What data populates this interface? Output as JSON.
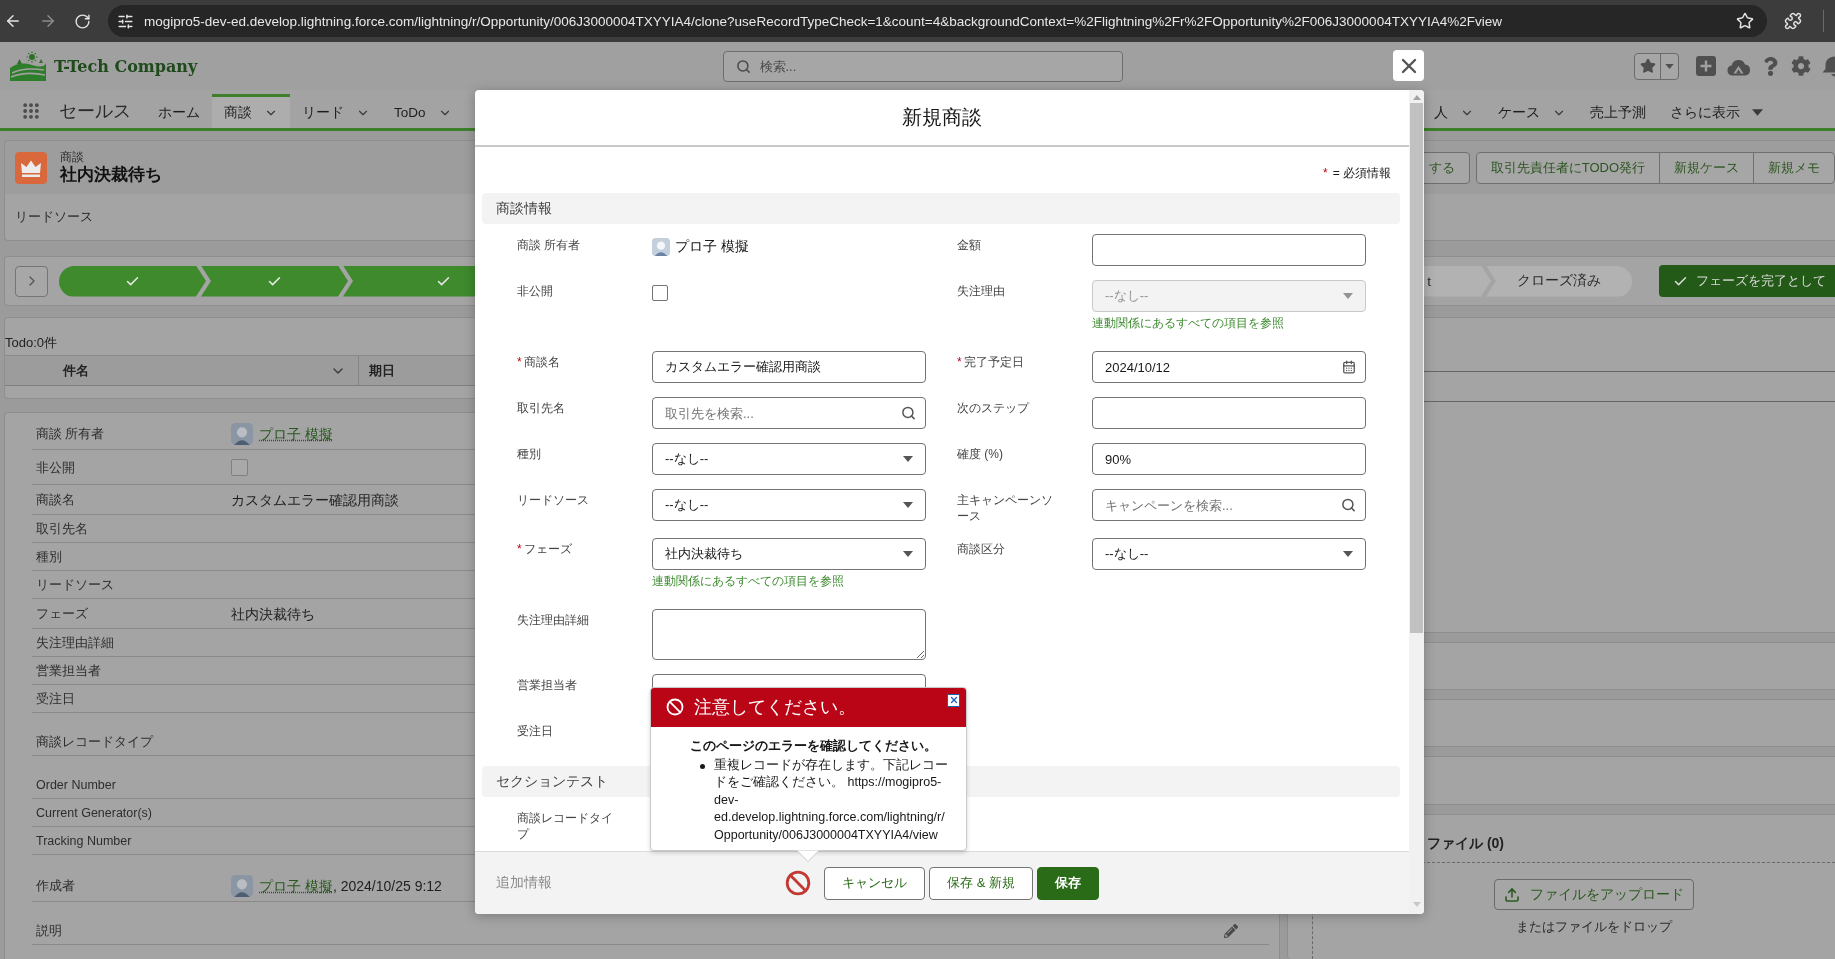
{
  "browser": {
    "url": "mogipro5-dev-ed.develop.lightning.force.com/lightning/r/Opportunity/006J3000004TXYYIA4/clone?useRecordTypeCheck=1&count=4&backgroundContext=%2Flightning%2Fr%2FOpportunity%2F006J3000004TXYYIA4%2Fview"
  },
  "header": {
    "brand": "T-Tech Company",
    "search": {
      "placeholder": "検索..."
    }
  },
  "nav": {
    "app_name": "セールス",
    "items": [
      {
        "label": "ホーム",
        "kind": "link",
        "selected": false
      },
      {
        "label": "商談",
        "kind": "dropdown",
        "selected": true
      },
      {
        "label": "リード",
        "kind": "dropdown",
        "selected": false
      },
      {
        "label": "ToDo",
        "kind": "dropdown",
        "selected": false
      }
    ],
    "overflow_items": [
      {
        "label": "人",
        "kind": "dropdown",
        "selected": false
      },
      {
        "label": "ケース",
        "kind": "dropdown",
        "selected": false
      },
      {
        "label": "売上予測",
        "kind": "link",
        "selected": false
      },
      {
        "label": "さらに表示",
        "kind": "more",
        "selected": false
      }
    ]
  },
  "record": {
    "object_label": "商談",
    "title": "社内決裁待ち",
    "field_label": "リードソース",
    "action_groups": [
      [
        "する"
      ],
      [
        "取引先責任者にTODO発行",
        "新規ケース",
        "新規メモ"
      ]
    ]
  },
  "path": {
    "leading_stages": [
      {
        "completed": true
      },
      {
        "completed": true
      },
      {
        "completed": true
      }
    ],
    "trailing_stages": [
      {
        "label": "t",
        "completed": false
      },
      {
        "label": "クローズ済み",
        "completed": false
      }
    ],
    "complete_button": "フェーズを完了として"
  },
  "activity": {
    "todo_count": "Todo:0件",
    "columns": [
      {
        "label": "件名",
        "menu": true
      },
      {
        "label": "期日"
      }
    ]
  },
  "details": {
    "groups": [
      {
        "rows": [
          {
            "label": "商談 所有者",
            "kind": "user",
            "value": "プロ子 模擬",
            "editable": false
          },
          {
            "label": "非公開",
            "kind": "checkbox",
            "checked": false,
            "editable": false
          },
          {
            "label": "商談名",
            "kind": "text",
            "value": "カスタムエラー確認用商談",
            "editable": false
          },
          {
            "label": "取引先名",
            "kind": "text",
            "editable": false
          },
          {
            "label": "種別",
            "kind": "text",
            "editable": false
          },
          {
            "label": "リードソース",
            "kind": "text",
            "editable": false
          },
          {
            "label": "フェーズ",
            "kind": "text",
            "value": "社内決裁待ち",
            "editable": false
          },
          {
            "label": "失注理由詳細",
            "kind": "text",
            "editable": false
          },
          {
            "label": "営業担当者",
            "kind": "text",
            "editable": false
          },
          {
            "label": "受注日",
            "kind": "text",
            "editable": false
          }
        ]
      },
      {
        "rows": [
          {
            "label": "商談レコードタイプ",
            "kind": "text",
            "editable": false
          }
        ]
      },
      {
        "rows": [
          {
            "label": "Order Number",
            "kind": "text",
            "editable": false
          },
          {
            "label": "Current Generator(s)",
            "kind": "text",
            "editable": false
          },
          {
            "label": "Tracking Number",
            "kind": "text",
            "editable": false
          }
        ]
      },
      {
        "rows": [
          {
            "label": "作成者",
            "kind": "user",
            "value": "プロ子 模擬",
            "suffix": ", 2024/10/25 9:12",
            "editable": false
          }
        ]
      },
      {
        "rows": [
          {
            "label": "説明",
            "kind": "text",
            "editable": true
          }
        ]
      }
    ]
  },
  "related": {
    "files_title": "ファイル (0)",
    "upload_button": "ファイルをアップロード",
    "drop_hint": "またはファイルをドロップ"
  },
  "modal": {
    "title": "新規商談",
    "required_legend": {
      "mark": "*",
      "text": "= 必須情報"
    },
    "sections": [
      {
        "title": "商談情報",
        "rows": [
          {
            "left": {
              "label": "商談 所有者",
              "kind": "user",
              "value": "プロ子 模擬",
              "required": false
            },
            "right": {
              "label": "金額",
              "kind": "text",
              "required": false
            }
          },
          {
            "left": {
              "label": "非公開",
              "kind": "checkbox",
              "checked": false,
              "required": false
            },
            "right": {
              "label": "失注理由",
              "kind": "select",
              "value": "--なし--",
              "disabled": true,
              "required": false,
              "help": "連動関係にあるすべての項目を参照"
            }
          },
          {
            "left": {
              "label": "商談名",
              "kind": "text",
              "value": "カスタムエラー確認用商談",
              "required": true
            },
            "right": {
              "label": "完了予定日",
              "kind": "date",
              "value": "2024/10/12",
              "required": true
            }
          },
          {
            "left": {
              "label": "取引先名",
              "kind": "lookup",
              "placeholder": "取引先を検索...",
              "required": false
            },
            "right": {
              "label": "次のステップ",
              "kind": "text",
              "required": false
            }
          },
          {
            "left": {
              "label": "種別",
              "kind": "select",
              "value": "--なし--",
              "disabled": false,
              "required": false
            },
            "right": {
              "label": "確度 (%)",
              "kind": "text",
              "value": "90%",
              "required": false
            }
          },
          {
            "left": {
              "label": "リードソース",
              "kind": "select",
              "value": "--なし--",
              "disabled": false,
              "required": false
            },
            "right": {
              "label": "主キャンペーンソース",
              "kind": "lookup",
              "placeholder": "キャンペーンを検索...",
              "required": false
            }
          },
          {
            "left": {
              "label": "フェーズ",
              "kind": "select",
              "value": "社内決裁待ち",
              "disabled": false,
              "required": true,
              "help": "連動関係にあるすべての項目を参照"
            },
            "right": {
              "label": "商談区分",
              "kind": "select",
              "value": "--なし--",
              "disabled": false,
              "required": false
            }
          },
          {
            "left": {
              "label": "失注理由詳細",
              "kind": "textarea",
              "required": false
            }
          },
          {
            "left": {
              "label": "営業担当者",
              "kind": "text",
              "required": false
            }
          },
          {
            "left": {
              "label": "受注日",
              "required": false
            }
          }
        ]
      },
      {
        "title": "セクションテスト",
        "rows": [
          {
            "left": {
              "label": "商談レコードタイプ",
              "required": false
            }
          }
        ]
      }
    ],
    "faded_section_title": "追加情報",
    "error": {
      "title": "注意してください。",
      "heading": "このページのエラーを確認してください。",
      "items": [
        "重複レコードが存在します。下記レコードをご確認ください。 https://mogipro5-dev-ed.develop.lightning.force.com/lightning/r/Opportunity/006J3000004TXYYIA4/view"
      ]
    },
    "buttons": [
      {
        "label": "キャンセル",
        "kind": "neutral"
      },
      {
        "label": "保存 & 新規",
        "kind": "neutral"
      },
      {
        "label": "保存",
        "kind": "brand"
      }
    ]
  }
}
